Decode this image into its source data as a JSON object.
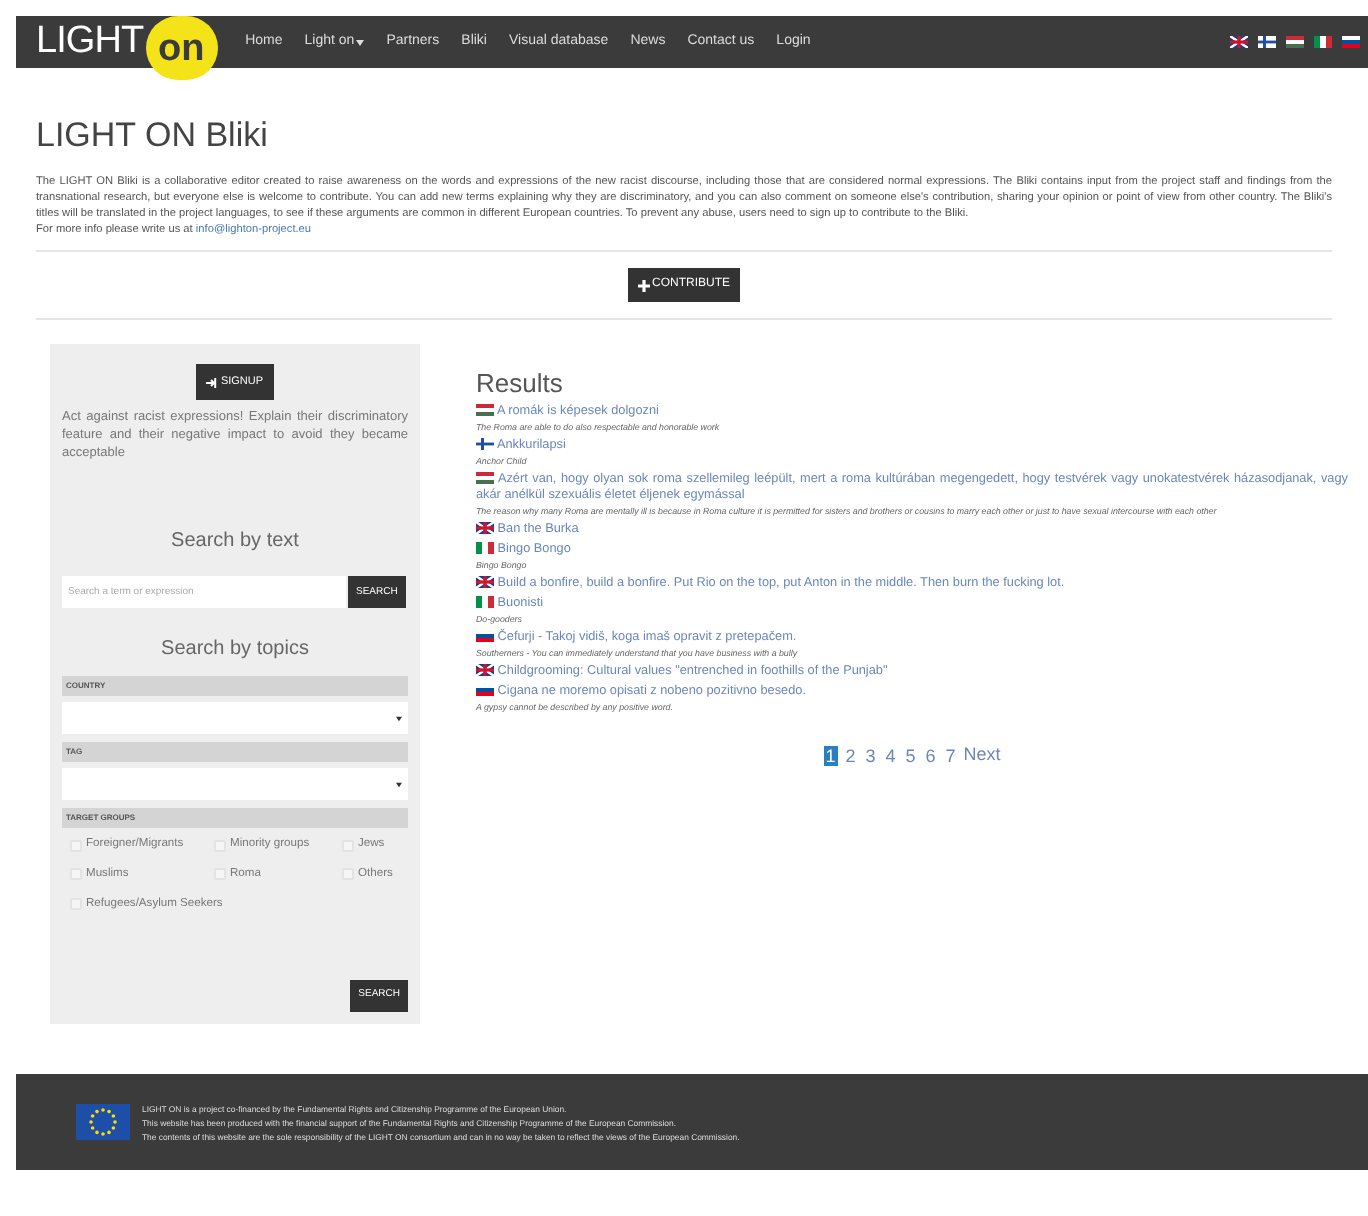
{
  "header": {
    "logo": {
      "text": "LIGHT",
      "badge": "on"
    },
    "nav": [
      {
        "label": "Home",
        "dropdown": false
      },
      {
        "label": "Light on",
        "dropdown": true
      },
      {
        "label": "Partners",
        "dropdown": false
      },
      {
        "label": "Bliki",
        "dropdown": false
      },
      {
        "label": "Visual database",
        "dropdown": false
      },
      {
        "label": "News",
        "dropdown": false
      },
      {
        "label": "Contact us",
        "dropdown": false
      },
      {
        "label": "Login",
        "dropdown": false
      }
    ],
    "languages": [
      {
        "kind": "gb"
      },
      {
        "kind": "fi"
      },
      {
        "kind": "hu"
      },
      {
        "kind": "it"
      },
      {
        "kind": "si"
      }
    ]
  },
  "intro": {
    "title": "LIGHT ON Bliki",
    "text": "The LIGHT ON Bliki is a collaborative editor created to raise awareness on the words and expressions of the new racist discourse, including those that are considered normal expressions. The Bliki contains input from the project staff and findings from the transnational research, but everyone else is welcome to contribute. You can add new terms explaining why they are discriminatory, and you can also comment on someone else's contribution, sharing your opinion or point of view from other country. The Bliki's titles will be translated in the project languages, to see if these arguments are common in different European countries. To prevent any abuse, users need to sign up to contribute to the Bliki.",
    "contact_text": "For more info please write us at",
    "contact_link": "info@lighton-project.eu",
    "contribute_button": "CONTRIBUTE"
  },
  "sidebar": {
    "signup_button": "SIGNUP",
    "tagline": "Act against racist expressions! Explain their discriminatory feature and their negative impact to avoid they became acceptable",
    "search_by_text": {
      "heading": "Search by text",
      "placeholder": "Search a term or expression",
      "button": "SEARCH"
    },
    "search_by_topics": {
      "heading": "Search by topics",
      "country_label": "COUNTRY",
      "tag_label": "TAG",
      "target_groups_label": "TARGET GROUPS",
      "target_groups": [
        {
          "label": "Foreigner/Migrants",
          "checked": false
        },
        {
          "label": "Minority groups",
          "checked": false
        },
        {
          "label": "Jews",
          "checked": false
        },
        {
          "label": "Muslims",
          "checked": false
        },
        {
          "label": "Roma",
          "checked": false
        },
        {
          "label": "Others",
          "checked": false
        },
        {
          "label": "Refugees/Asylum Seekers",
          "checked": false
        }
      ],
      "button": "SEARCH"
    }
  },
  "results": {
    "heading": "Results",
    "items": [
      {
        "kind": "hu",
        "title": "A romák is képesek dolgozni",
        "translation": "The Roma are able to do also respectable and honorable work"
      },
      {
        "kind": "fi",
        "title": "Ankkurilapsi",
        "translation": "Anchor Child"
      },
      {
        "kind": "hu",
        "title": "Azért van, hogy olyan sok roma szellemileg leépült, mert a roma kultúrában megengedett, hogy testvérek vagy unokatestvérek házasodjanak, vagy akár anélkül szexuális életet éljenek egymással",
        "translation": "The reason why many Roma are mentally ill is because in Roma culture it is permitted for sisters and brothers or cousins to marry each other or just to have sexual intercourse with each other"
      },
      {
        "kind": "gb",
        "title": "Ban the Burka"
      },
      {
        "kind": "it",
        "title": "Bingo Bongo",
        "translation": "Bingo Bongo"
      },
      {
        "kind": "gb",
        "title": "Build a bonfire, build a bonfire. Put Rio on the top, put Anton in the middle. Then burn the fucking lot."
      },
      {
        "kind": "it",
        "title": "Buonisti",
        "translation": "Do-gooders"
      },
      {
        "kind": "si",
        "title": "Čefurji - Takoj vidiš, koga imaš opravit z pretepačem.",
        "translation": "Southerners - You can immediately understand that you have business with a bully"
      },
      {
        "kind": "gb",
        "title": "Childgrooming: Cultural values \"entrenched in foothills of the Punjab\""
      },
      {
        "kind": "si",
        "title": "Cigana ne moremo opisati z nobeno pozitivno besedo.",
        "translation": "A gypsy cannot be described by any positive word."
      }
    ],
    "pagination": [
      {
        "label": "1",
        "selected": true
      },
      {
        "label": "2",
        "selected": false
      },
      {
        "label": "3",
        "selected": false
      },
      {
        "label": "4",
        "selected": false
      },
      {
        "label": "5",
        "selected": false
      },
      {
        "label": "6",
        "selected": false
      },
      {
        "label": "7",
        "selected": false
      }
    ],
    "next": "Next"
  },
  "footer": {
    "lines": [
      "LIGHT ON is a project co-financed by the Fundamental Rights and Citizenship Programme of the European Union.",
      "This website has been produced with the financial support of the Fundamental Rights and Citizenship Programme of the European Commission.",
      "The contents of this website are the sole responsibility of the LIGHT ON consortium and can in no way be taken to reflect the views of the European Commission."
    ]
  }
}
